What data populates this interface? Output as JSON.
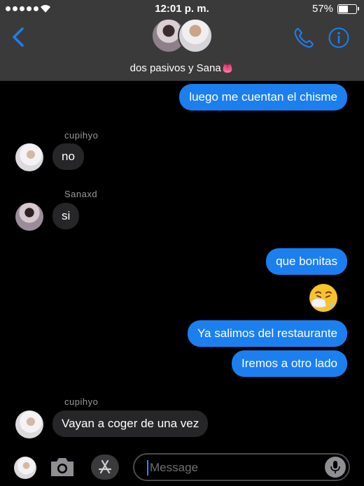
{
  "status_bar": {
    "time": "12:01 p. m.",
    "battery_percent": "57%",
    "battery_level": 0.57,
    "signal_icon": "signal-dots-icon",
    "wifi_icon": "wifi-icon"
  },
  "header": {
    "group_name": "dos pasivos y Sana👅",
    "back_icon": "chevron-left-icon",
    "call_icon": "phone-icon",
    "info_icon": "info-icon"
  },
  "messages": [
    {
      "direction": "out",
      "text": "luego me cuentan el chisme"
    },
    {
      "direction": "in",
      "sender": "cupihyo",
      "text": "no"
    },
    {
      "direction": "in",
      "sender": "Sanaxd",
      "text": "si"
    },
    {
      "direction": "out",
      "text": "que bonitas"
    },
    {
      "direction": "out",
      "type": "emoji",
      "text": "🤧"
    },
    {
      "direction": "out",
      "text": "Ya salimos del restaurante"
    },
    {
      "direction": "out",
      "text": "Iremos a otro lado"
    },
    {
      "direction": "in",
      "sender": "cupihyo",
      "text": "Vayan a coger de una vez"
    }
  ],
  "input_bar": {
    "placeholder": "Message",
    "camera_icon": "camera-icon",
    "apps_icon": "app-store-icon",
    "mic_icon": "microphone-icon"
  },
  "colors": {
    "outgoing_bubble": "#1b7ff0",
    "incoming_bubble": "#262628",
    "accent": "#2f86ff",
    "header_bg": "#3a3a3a"
  }
}
